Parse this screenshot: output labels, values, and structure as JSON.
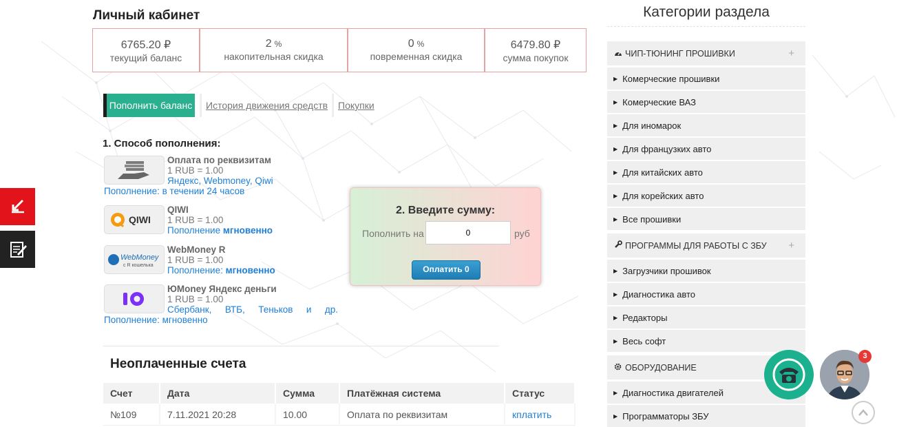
{
  "account": {
    "title": "Личный кабинет",
    "stats": [
      {
        "value": "6765.20",
        "unit": "₽",
        "label": "текущий баланс"
      },
      {
        "value": "2",
        "unit": "%",
        "label": "накопительная скидка"
      },
      {
        "value": "0",
        "unit": "%",
        "label": "повременная скидка"
      },
      {
        "value": "6479.80",
        "unit": "₽",
        "label": "сумма покупок"
      }
    ]
  },
  "tabs": {
    "balance": "Пополнить баланс",
    "history": "История движения средств",
    "purchases": "Покупки"
  },
  "payment": {
    "title": "1. Способ пополнения:",
    "methods": [
      {
        "name": "Оплата по реквизитам",
        "rate": "1 RUB = 1.00",
        "info": "Яндекс, Webmoney, Qiwi",
        "timing": "Пополнение: в течении 24 часов",
        "logo": "bank-hand-icon"
      },
      {
        "name": "QIWI",
        "rate": "1 RUB = 1.00",
        "timing_prefix": "Пополнение",
        "timing_bold": "мгновенно",
        "logo": "qiwi-logo"
      },
      {
        "name": "WebMoney R",
        "rate": "1 RUB = 1.00",
        "timing_prefix": "Пополнение:",
        "timing_bold": "мгновенно",
        "logo": "webmoney-logo"
      },
      {
        "name": "ЮMoney Яндекс деньги",
        "rate": "1 RUB = 1.00",
        "info": "Сбербанк, ВТБ, Теньков и др.",
        "timing": "Пополнение: мгновенно",
        "logo": "yoomoney-logo"
      }
    ],
    "logo_text": {
      "qiwi": "QIWI",
      "webmoney": "WebMoney",
      "webmoney_sub": "с R кошелька"
    }
  },
  "amount": {
    "title": "2. Введите сумму:",
    "label": "Пополнить на",
    "value": "0",
    "unit": "руб",
    "button": "Оплатить 0"
  },
  "invoices": {
    "title": "Неоплаченные счета",
    "columns": [
      "Счет",
      "Дата",
      "Сумма",
      "Платёжная система",
      "Статус"
    ],
    "rows": [
      [
        "№109",
        "7.11.2021 20:28",
        "10.00",
        "Оплата по реквизитам",
        "кплатить"
      ]
    ]
  },
  "sidebar": {
    "title": "Категории раздела",
    "groups": [
      {
        "label": "ЧИП-ТЮНИНГ ПРОШИВКИ",
        "icon": "speedometer-icon",
        "items": [
          "Комерческие прошивки",
          "Комерческие ВАЗ",
          "Для иномарок",
          "Для французких авто",
          "Для китайских авто",
          "Для корейских авто",
          "Все прошивки"
        ]
      },
      {
        "label": "ПРОГРАММЫ ДЛЯ РАБОТЫ С ЗБУ",
        "icon": "wrench-icon",
        "items": [
          "Загрузчики прошивок",
          "Диагностика авто",
          "Редакторы",
          "Весь софт"
        ]
      },
      {
        "label": "ОБОРУДОВАНИЕ",
        "icon": "gear-icon",
        "items": [
          "Диагностика двигателей",
          "Программаторы ЗБУ"
        ]
      }
    ],
    "plus": "+"
  },
  "widgets": {
    "badge_count": "3"
  },
  "colors": {
    "accent": "#2bb08f",
    "link": "#1e7fd6",
    "stat_border": "#e8a0a0",
    "side_red": "#e3131b"
  }
}
